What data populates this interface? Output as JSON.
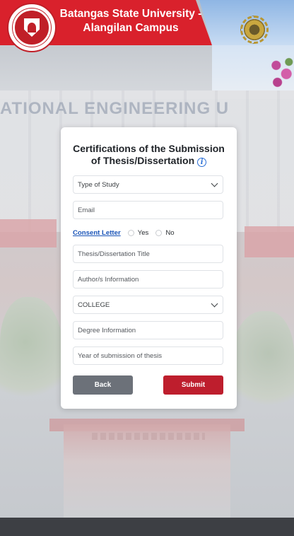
{
  "header": {
    "title": "Batangas State University - Alangilan Campus"
  },
  "form": {
    "title": "Certifications of the Submission of Thesis/Dissertation",
    "type_of_study": "Type of Study",
    "email_placeholder": "Email",
    "consent_label": "Consent Letter",
    "consent_yes": "Yes",
    "consent_no": "No",
    "title_placeholder": "Thesis/Dissertation Title",
    "author_placeholder": "Author/s Information",
    "college": "COLLEGE",
    "degree_placeholder": "Degree Information",
    "year_placeholder": "Year of submission of thesis",
    "back_label": "Back",
    "submit_label": "Submit"
  },
  "background": {
    "banner_text": "ATIONAL ENGINEERING U"
  },
  "colors": {
    "brand_red": "#d9212c",
    "submit_red": "#be1e2d",
    "back_gray": "#6c7179",
    "link_blue": "#1a55b8"
  }
}
